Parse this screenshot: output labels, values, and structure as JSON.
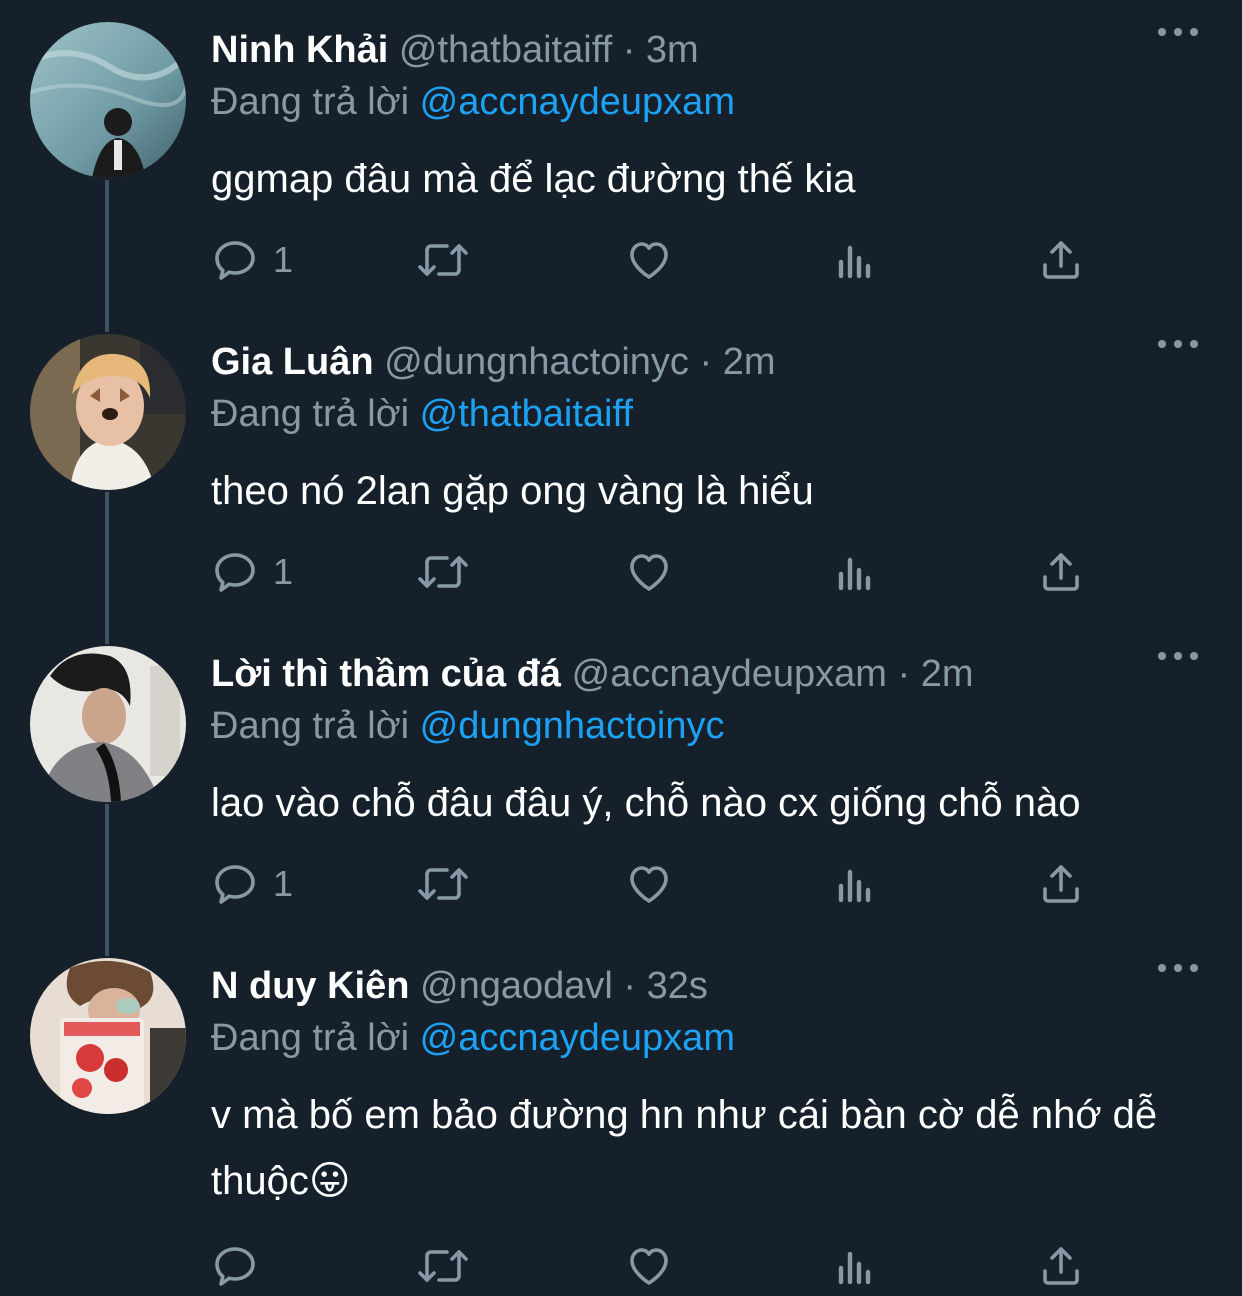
{
  "colors": {
    "background": "#15202b",
    "secondary_text": "#8899a6",
    "mention": "#1da1f2",
    "thread_line": "#3d5466"
  },
  "tweets": [
    {
      "name": "Ninh Khải",
      "handle": "@thatbaitaiff",
      "time": "· 3m",
      "reply_prefix": "Đang trả lời",
      "reply_to": "@accnaydeupxam",
      "text": "ggmap đâu mà để lạc đường thế kia",
      "reply_count": "1",
      "avatar_icon": "profile-photo"
    },
    {
      "name": "Gia Luân",
      "handle": "@dungnhactoinyc",
      "time": "· 2m",
      "reply_prefix": "Đang trả lời",
      "reply_to": "@thatbaitaiff",
      "text": "theo nó 2lan gặp ong vàng là hiểu",
      "reply_count": "1",
      "avatar_icon": "profile-photo"
    },
    {
      "name": "Lời thì thầm của đá",
      "handle": "@accnaydeupxam",
      "time": "· 2m",
      "reply_prefix": "Đang trả lời",
      "reply_to": "@dungnhactoinyc",
      "text": "lao vào chỗ đâu đâu ý, chỗ nào cx giống chỗ nào",
      "reply_count": "1",
      "avatar_icon": "profile-photo"
    },
    {
      "name": "N duy Kiên",
      "handle": "@ngaodavl",
      "time": "· 32s",
      "reply_prefix": "Đang trả lời",
      "reply_to": "@accnaydeupxam",
      "text": "v mà bố em bảo đường hn như cái bàn cờ dễ nhớ dễ thuộc😛",
      "reply_count": "",
      "avatar_icon": "profile-photo"
    }
  ],
  "action_icons": [
    "reply-icon",
    "retweet-icon",
    "like-icon",
    "analytics-icon",
    "share-icon"
  ]
}
